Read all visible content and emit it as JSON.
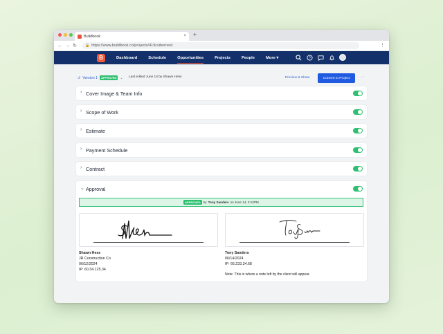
{
  "browser": {
    "tab_title": "Buildbook",
    "tab_close": "×",
    "new_tab": "+",
    "url": "https://www.buildbook.co/projects/419csibornest"
  },
  "nav": {
    "logo": "B",
    "items": [
      "Dashboard",
      "Schedule",
      "Opportunities",
      "Projects",
      "People",
      "More ▾"
    ],
    "active_index": 2
  },
  "toolbar": {
    "version_label": "Version 1",
    "version_badge": "APPROVED",
    "last_edited": "Last edited June 14 by Shawn Hess",
    "preview_label": "Preview & Share",
    "convert_label": "Convert to Project",
    "more_label": "···"
  },
  "sections": [
    {
      "label": "Cover Image & Team Info",
      "enabled": true
    },
    {
      "label": "Scope of Work",
      "enabled": true
    },
    {
      "label": "Estimate",
      "enabled": true
    },
    {
      "label": "Payment Schedule",
      "enabled": true
    },
    {
      "label": "Contract",
      "enabled": true
    }
  ],
  "approval": {
    "title": "Approval",
    "enabled": true,
    "banner_badge": "APPROVED",
    "banner_by": "by",
    "banner_name": "Tony Sanders",
    "banner_date": "on June 14, 3:12PM",
    "contractor": {
      "name": "Shawn Hess",
      "company": "JR Construction Co",
      "date": "06/12/2024",
      "ip": "IP: 60.34.125.34"
    },
    "client": {
      "name": "Tony Sanders",
      "date": "06/14/2024",
      "ip": "IP: 66.233.34.68",
      "note": "Note: This is where a note left by the client will appear."
    }
  },
  "colors": {
    "nav_bg": "#13306b",
    "accent": "#1f5ae0",
    "success": "#2fbf71",
    "brand": "#f05a3a"
  }
}
